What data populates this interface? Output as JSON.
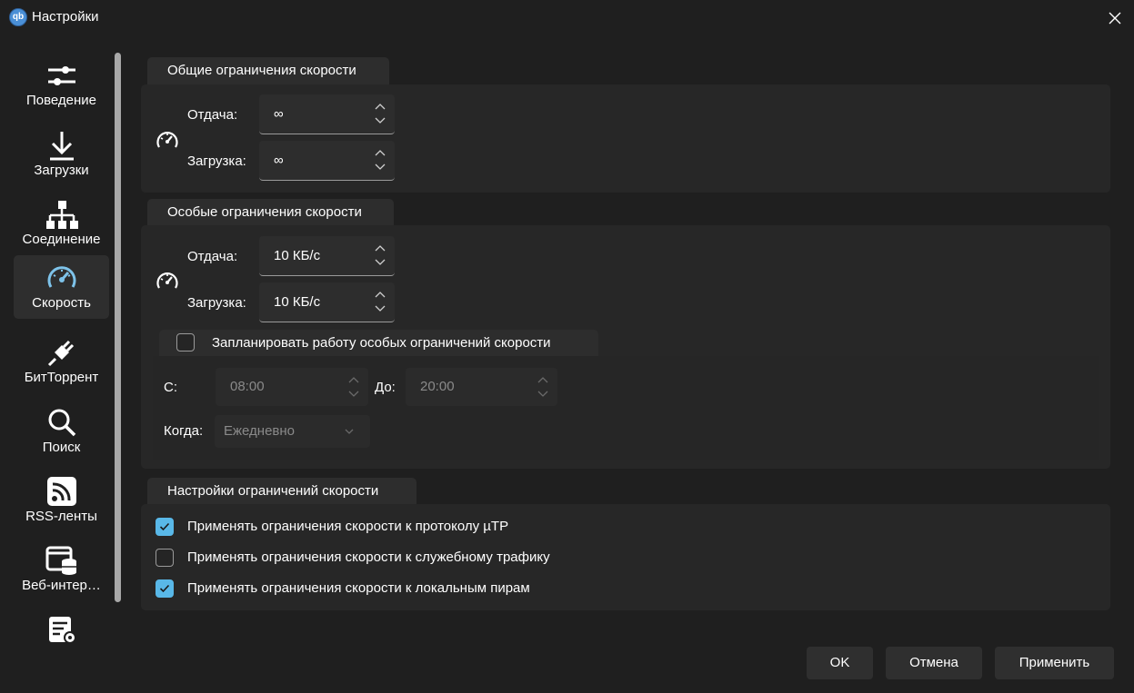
{
  "window": {
    "app_icon_text": "qb",
    "title": "Настройки"
  },
  "sidebar": {
    "items": [
      {
        "label": "Поведение",
        "icon": "sliders-icon"
      },
      {
        "label": "Загрузки",
        "icon": "download-icon"
      },
      {
        "label": "Соединение",
        "icon": "network-icon"
      },
      {
        "label": "Скорость",
        "icon": "speedometer-icon",
        "active": true
      },
      {
        "label": "БитТоррент",
        "icon": "plug-icon"
      },
      {
        "label": "Поиск",
        "icon": "search-icon"
      },
      {
        "label": "RSS-ленты",
        "icon": "rss-icon"
      },
      {
        "label": "Веб-интер…",
        "icon": "web-ui-icon"
      },
      {
        "label": "",
        "icon": "advanced-settings-icon"
      }
    ]
  },
  "global_limits": {
    "title": "Общие ограничения скорости",
    "upload_label": "Отдача:",
    "upload_value": "∞",
    "download_label": "Загрузка:",
    "download_value": "∞"
  },
  "alt_limits": {
    "title": "Особые ограничения скорости",
    "upload_label": "Отдача:",
    "upload_value": "10 КБ/с",
    "download_label": "Загрузка:",
    "download_value": "10 КБ/с",
    "schedule_label": "Запланировать работу особых ограничений скорости",
    "schedule_checked": false,
    "from_label": "С:",
    "from_value": "08:00",
    "to_label": "До:",
    "to_value": "20:00",
    "when_label": "Когда:",
    "when_value": "Ежедневно"
  },
  "limit_settings": {
    "title": "Настройки ограничений скорости",
    "options": [
      {
        "label": "Применять ограничения скорости к протоколу µTP",
        "checked": true
      },
      {
        "label": "Применять ограничения скорости к служебному трафику",
        "checked": false
      },
      {
        "label": "Применять ограничения скорости к локальным пирам",
        "checked": true
      }
    ]
  },
  "buttons": {
    "ok": "OK",
    "cancel": "Отмена",
    "apply": "Применить"
  },
  "colors": {
    "window_bg": "#1f1f1f",
    "group_bg": "#272727",
    "accent_check": "#59b8e8",
    "disabled_text": "#8a8a8a"
  }
}
